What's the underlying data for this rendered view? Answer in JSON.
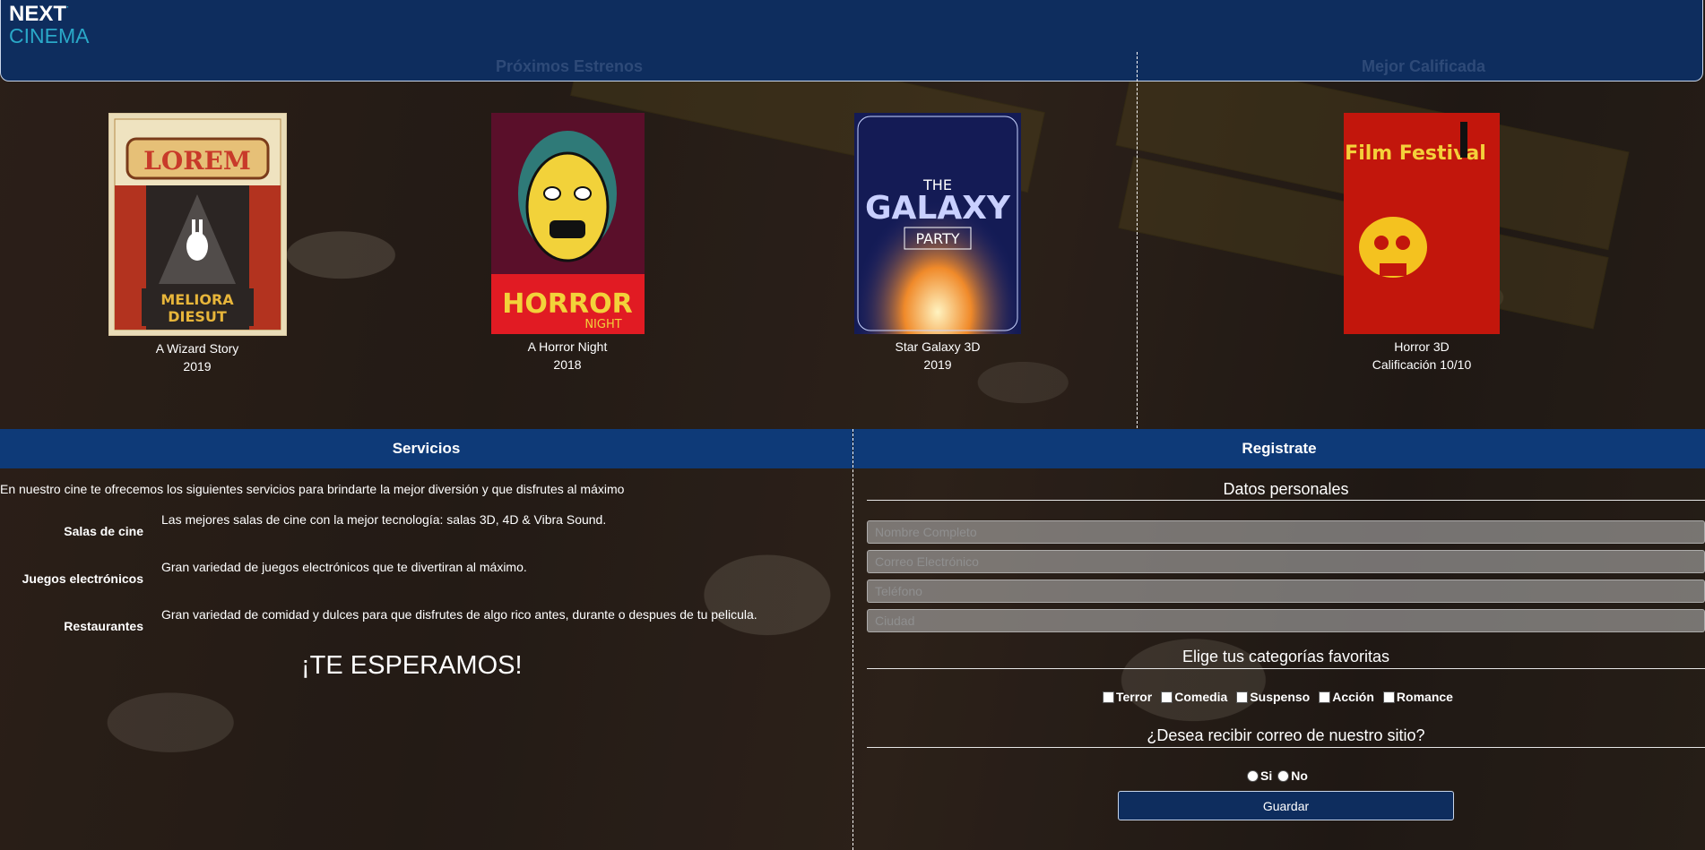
{
  "header": {
    "logo_next": "NEXT",
    "logo_sup": "·",
    "logo_cinema": "CINEMA",
    "upcoming_title": "Próximos Estrenos",
    "top_rated_title": "Mejor Calificada"
  },
  "movies": [
    {
      "title": "A Wizard Story",
      "sub": "2019",
      "poster_text_top": "LOREM",
      "poster_text_bottom": "MELIORA DIESUT"
    },
    {
      "title": "A Horror Night",
      "sub": "2018",
      "poster_text": "HORROR",
      "poster_text2": "NIGHT"
    },
    {
      "title": "Star Galaxy 3D",
      "sub": "2019",
      "poster_text": "GALAXY",
      "poster_text2": "PARTY",
      "poster_text_top": "THE"
    },
    {
      "title": "Horror 3D",
      "sub": "Calificación 10/10",
      "poster_text": "Film Festival"
    }
  ],
  "services": {
    "title": "Servicios",
    "intro": "En nuestro cine te ofrecemos los siguientes servicios para brindarte la mejor diversión y que disfrutes al máximo",
    "items": [
      {
        "label": "Salas de cine",
        "desc": "Las mejores salas de cine con la mejor tecnología: salas 3D, 4D & Vibra Sound."
      },
      {
        "label": "Juegos electrónicos",
        "desc": "Gran variedad de juegos electrónicos que te divertiran al máximo."
      },
      {
        "label": "Restaurantes",
        "desc": "Gran variedad de comidad y dulces para que disfrutes de algo rico antes, durante o despues de tu pelicula."
      }
    ],
    "closing": "¡TE ESPERAMOS!"
  },
  "register": {
    "title": "Registrate",
    "personal_title": "Datos personales",
    "fields": {
      "name_placeholder": "Nombre Completo",
      "email_placeholder": "Correo Electrónico",
      "phone_placeholder": "Teléfono",
      "city_placeholder": "Ciudad"
    },
    "categories_title": "Elige tus categorías favoritas",
    "categories": [
      "Terror",
      "Comedia",
      "Suspenso",
      "Acción",
      "Romance"
    ],
    "mail_question": "¿Desea recibir correo de nuestro sitio?",
    "yes": "Si",
    "no": "No",
    "submit": "Guardar"
  },
  "colors": {
    "header": "#0e2d5e",
    "bar": "#0e3a78",
    "accent": "#2aa8c8"
  }
}
